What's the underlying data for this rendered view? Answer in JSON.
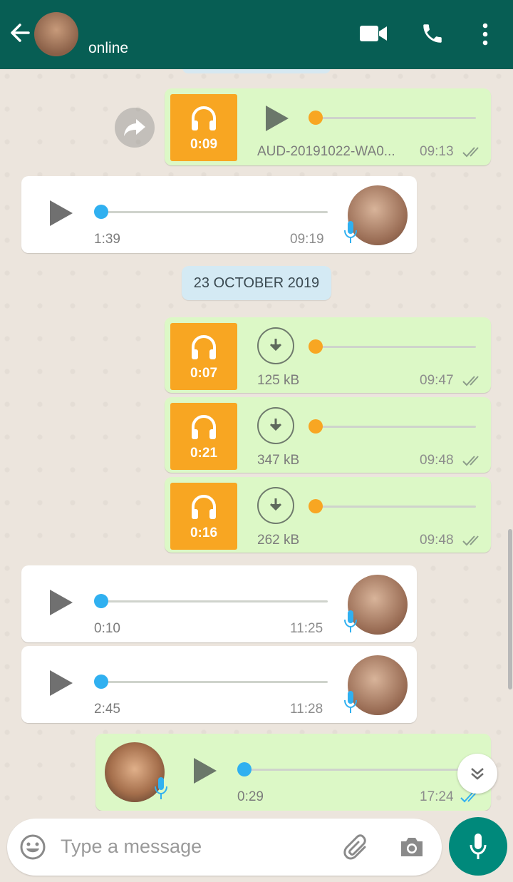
{
  "header": {
    "status": "online"
  },
  "messages": [
    {
      "type": "outgoing-audio",
      "duration": "0:09",
      "filename": "AUD-20191022-WA0...",
      "time": "09:13"
    },
    {
      "type": "incoming-voice",
      "length": "1:39",
      "time": "09:19"
    },
    {
      "type": "date",
      "label": "23 OCTOBER 2019"
    },
    {
      "type": "outgoing-audio",
      "duration": "0:07",
      "size": "125 kB",
      "time": "09:47"
    },
    {
      "type": "outgoing-audio",
      "duration": "0:21",
      "size": "347 kB",
      "time": "09:48"
    },
    {
      "type": "outgoing-audio",
      "duration": "0:16",
      "size": "262 kB",
      "time": "09:48"
    },
    {
      "type": "incoming-voice",
      "length": "0:10",
      "time": "11:25"
    },
    {
      "type": "incoming-voice",
      "length": "2:45",
      "time": "11:28"
    },
    {
      "type": "outgoing-voice",
      "length": "0:29",
      "time": "17:24"
    }
  ],
  "input": {
    "placeholder": "Type a message"
  },
  "colors": {
    "header": "#075e54",
    "outgoing": "#dcf8c6",
    "accent_orange": "#f8a622",
    "voice_blue": "#30b0f0",
    "send": "#00897b"
  },
  "icons": [
    "back-arrow-icon",
    "video-call-icon",
    "phone-icon",
    "more-vert-icon",
    "headphones-icon",
    "play-icon",
    "download-icon",
    "mic-icon",
    "forward-icon",
    "double-check-icon",
    "emoji-icon",
    "attach-icon",
    "camera-icon",
    "scroll-down-icon"
  ]
}
